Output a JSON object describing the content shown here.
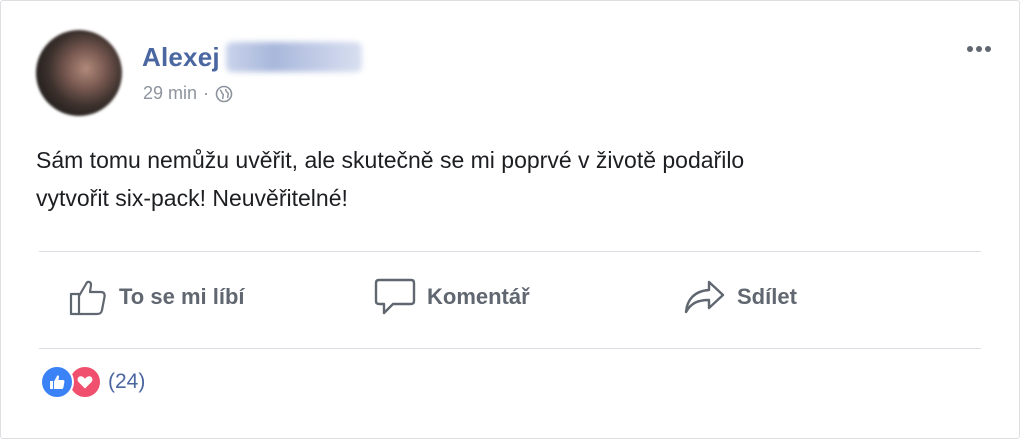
{
  "post": {
    "author": {
      "first_name": "Alexej",
      "surname_blurred": true
    },
    "timestamp": "29 min",
    "separator": "·",
    "privacy_icon": "globe-icon",
    "more_icon": "more-options-icon",
    "text_line1": "Sám tomu nemůžu uvěřit, ale skutečně se mi poprvé v životě podařilo",
    "text_line2": "vytvořit six-pack! Neuvěřitelné!"
  },
  "actions": {
    "like_label": "To se mi líbí",
    "comment_label": "Komentář",
    "share_label": "Sdílet"
  },
  "reactions": {
    "icons": [
      "like-reaction-icon",
      "love-reaction-icon"
    ],
    "count": "(24)"
  },
  "colors": {
    "author_blue": "#4b67a1",
    "muted_gray": "#8d949e",
    "action_gray": "#606770",
    "like_blue": "#3b82f6",
    "love_red": "#f0506e"
  }
}
